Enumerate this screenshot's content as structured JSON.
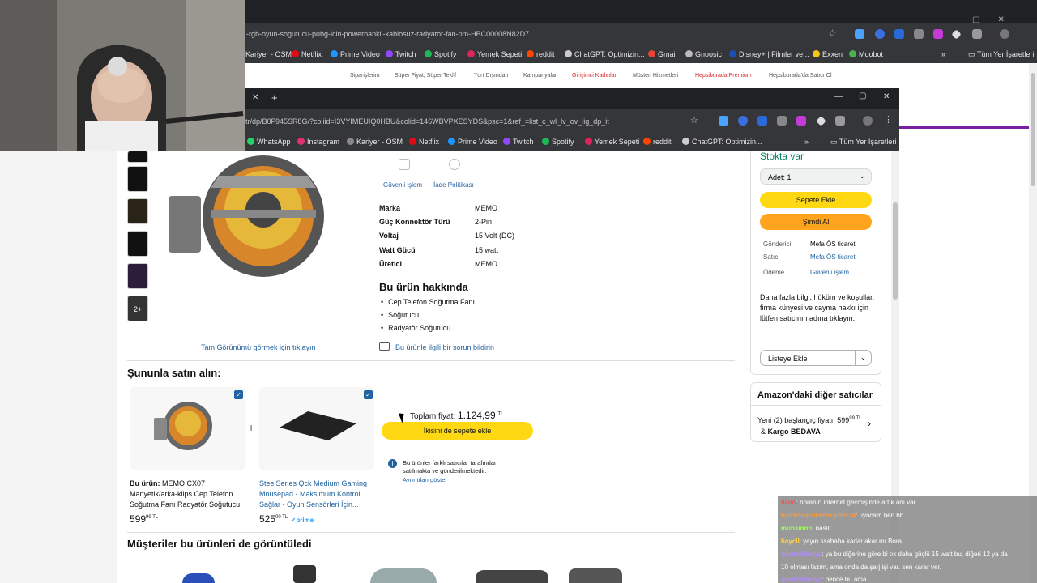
{
  "back_browser": {
    "url": "-rgb-oyun-sogutucu-pubg-icin-powerbankli-kablosuz-radyator-fan-pm-HBC00008N82D7",
    "bookmarks": [
      "Kariyer - OSM",
      "Netflix",
      "Prime Video",
      "Twitch",
      "Spotify",
      "Yemek Sepeti",
      "reddit",
      "ChatGPT: Optimizin...",
      "Gmail",
      "Gnoosic",
      "Disney+ | Filmler ve...",
      "Exxen",
      "Moobot"
    ],
    "all_bookmarks": "Tüm Yer İşaretleri",
    "nav": [
      "Siparişlerim",
      "Süper Fiyat, Süper Teklif",
      "Yurt Dışından",
      "Kampanyalar",
      "Girişimci Kadınlar",
      "Müşteri Hizmetleri",
      "Hepsiburada Premium",
      "Hepsiburada'da Satıcı Ol"
    ]
  },
  "front_browser": {
    "url": "tr/dp/B0F945SR8G/?coliid=I3VYIMEUIQ0HBU&colid=146WBVPXESYDS&psc=1&ref_=list_c_wl_lv_ov_lig_dp_it",
    "bookmarks": [
      "WhatsApp",
      "Instagram",
      "Kariyer - OSM",
      "Netflix",
      "Prime Video",
      "Twitch",
      "Spotify",
      "Yemek Sepeti",
      "reddit",
      "ChatGPT: Optimizin..."
    ],
    "all_bookmarks": "Tüm Yer İşaretleri"
  },
  "product": {
    "trust": [
      "Güvenli işlem",
      "İade Politikası"
    ],
    "specs": [
      {
        "k": "Marka",
        "v": "MEMO"
      },
      {
        "k": "Güç Konnektör Türü",
        "v": "2-Pin"
      },
      {
        "k": "Voltaj",
        "v": "15 Volt (DC)"
      },
      {
        "k": "Watt Gücü",
        "v": "15 watt"
      },
      {
        "k": "Üretici",
        "v": "MEMO"
      }
    ],
    "about_title": "Bu ürün hakkında",
    "bullets": [
      "Cep Telefon Soğutma Fanı",
      "Soğutucu",
      "Radyatör Soğutucu"
    ],
    "full_view_link": "Tam Görünümü görmek için tıklayın",
    "report_link": "Bu ürünle ilgili bir sorun bildirin",
    "thumb_more": "2+"
  },
  "buybox": {
    "stock": "Stokta var",
    "qty": "Adet:  1",
    "add_to_cart": "Sepete Ekle",
    "buy_now": "Şimdi Al",
    "rows": [
      {
        "k": "Gönderici",
        "v": "Mefa ÖS ticaret"
      },
      {
        "k": "Satıcı",
        "v": "Mefa ÖS ticaret"
      },
      {
        "k": "Ödeme",
        "v": "Güvenli işlem"
      }
    ],
    "info": "Daha fazla bilgi, hüküm ve koşullar, firma künyesi ve cayma hakkı için lütfen satıcının adına tıklayın.",
    "list_button": "Listeye Ekle"
  },
  "other_sellers": {
    "title": "Amazon'daki diğer satıcılar",
    "line1": "Yeni (2) başlangıç fiyatı:",
    "price": "599",
    "price_sup": "99 TL",
    "shipping_prefix": "&",
    "shipping": "Kargo BEDAVA"
  },
  "fbt": {
    "title": "Şununla satın alın:",
    "item1_prefix": "Bu ürün:",
    "item1_name": "MEMO CX07 Manyetik/arka-klips Cep Telefon Soğutma Fanı Radyatör Soğutucu",
    "item1_price": "599",
    "item1_sup": "99 TL",
    "item2_name": "SteelSeries Qck Medium Gaming Mousepad - Maksimum Kontrol Sağlar - Oyun Sensörleri İçin...",
    "item2_price": "525",
    "item2_sup": "00 TL",
    "prime": "✓prime",
    "total_label": "Toplam fiyat:",
    "total": "1.124,99",
    "total_sup": "TL",
    "add_both": "İkisini de sepete ekle",
    "note": "Bu ürünler farklı satıcılar tarafından satılmakta ve gönderilmektedir.",
    "details": "Ayrıntıları göster"
  },
  "viewed_title": "Müşteriler bu ürünleri de görüntüledi",
  "chat": [
    {
      "user": "llaoo",
      "color": "#ff4d4d",
      "msg": ": boranın internet geçmişinde artık anı var"
    },
    {
      "user": "bahsrhepsikerekgider34",
      "color": "#ff9933",
      "msg": ": uyucam ben bb"
    },
    {
      "user": "muhsinnn",
      "color": "#9cff57",
      "msg": ": nasıl!"
    },
    {
      "user": "baycll",
      "color": "#ffd24d",
      "msg": ": yayın ssabaha kadar akar mı Bora"
    },
    {
      "user": "qwertyklavye",
      "color": "#b48cff",
      "msg": ": ya bu diğerine göre bi tık daha güçlü 15 watt bu, diğeri 12 ya da"
    },
    {
      "user": "",
      "color": "#ffffff",
      "msg": "10 olması lazım, ama onda da şarj işi var. sen karar ver."
    },
    {
      "user": "qwertyklavye",
      "color": "#b48cff",
      "msg": ": bence bu ama"
    }
  ]
}
